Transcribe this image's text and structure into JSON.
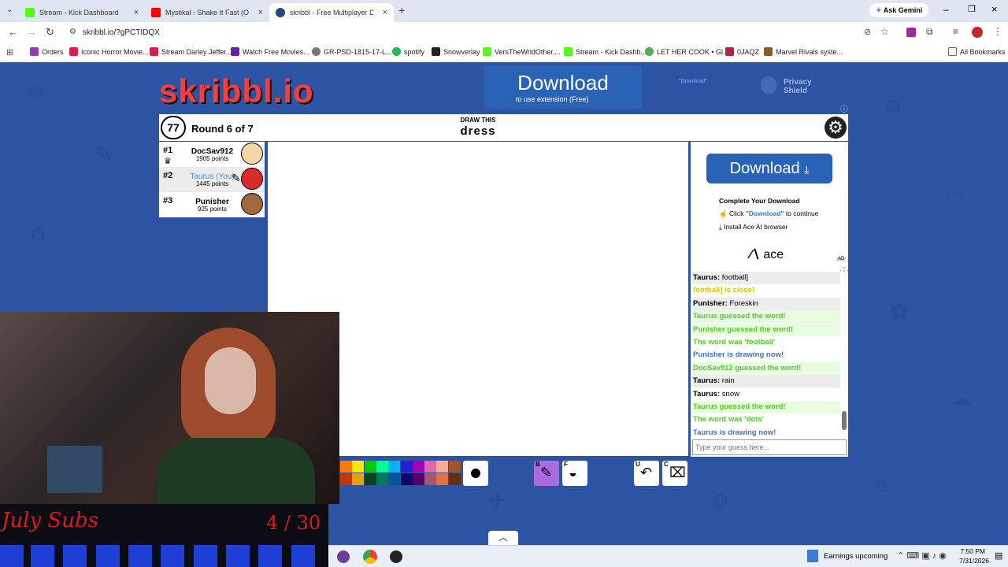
{
  "browser": {
    "tabs": [
      {
        "title": "Stream - Kick Dashboard",
        "color": "#53fc18"
      },
      {
        "title": "Mystikal - Shake It Fast (Offi",
        "color": "#ff0000"
      },
      {
        "title": "skribbl - Free Multiplayer D",
        "color": "#27467f"
      }
    ],
    "ask_gemini": "Ask Gemini",
    "url": "skribbl.io/?gPCTIDQX",
    "bookmarks": [
      "Orders",
      "Iconic Horror Movie...",
      "Stream Darley Jeffer...",
      "Watch Free Movies...",
      "GR-PSD-1815-17-L...",
      "spotify",
      "Snowverlay",
      "VersTheWrldOther,...",
      "Stream - Kick Dashb...",
      "LET HER COOK • Gl...",
      "0JAQZ",
      "Marvel Rivals syste..."
    ],
    "all_bookmarks": "All Bookmarks"
  },
  "ad_top": {
    "download": "Download",
    "sub": "to use extension (Free)",
    "privacy": "Privacy Shield",
    "tiny_download": "\"Download\""
  },
  "game": {
    "logo": "skribbl.io",
    "timer": "77",
    "round": "Round 6 of 7",
    "draw_this": "DRAW THIS",
    "word": "dress",
    "players": [
      {
        "rank": "#1",
        "name": "DocSav912",
        "points": "1905 points",
        "color": "#000000"
      },
      {
        "rank": "#2",
        "name": "Taurus (You)",
        "points": "1445 points",
        "color": "#4a8cd8"
      },
      {
        "rank": "#3",
        "name": "Punisher",
        "points": "925 points",
        "color": "#000000"
      }
    ],
    "tool_keys": {
      "brush": "B",
      "fill": "F",
      "undo": "U",
      "clear": "C"
    },
    "guess_placeholder": "Type your guess here..."
  },
  "ad_side": {
    "download": "Download",
    "complete": "Complete Your Download",
    "click_prefix": "Click",
    "click_link": "\"Download\"",
    "click_suffix": "to continue",
    "install": "Install Ace AI browser",
    "brand": "ace",
    "ad_label": "AD"
  },
  "chat": [
    {
      "name": "Taurus:",
      "text": "football]",
      "style": "gray"
    },
    {
      "name": "",
      "text": "football] is close!",
      "style": "yel"
    },
    {
      "name": "Punisher:",
      "text": "Foreskin",
      "style": "gray"
    },
    {
      "name": "",
      "text": "Taurus guessed the word!",
      "style": "g"
    },
    {
      "name": "",
      "text": "Punisher guessed the word!",
      "style": "g"
    },
    {
      "name": "",
      "text": "The word was 'football'",
      "style": "g-plain"
    },
    {
      "name": "",
      "text": "Punisher is drawing now!",
      "style": "blue"
    },
    {
      "name": "",
      "text": "DocSav912 guessed the word!",
      "style": "g"
    },
    {
      "name": "Taurus:",
      "text": "rain",
      "style": "gray"
    },
    {
      "name": "Taurus:",
      "text": "snow",
      "style": "plain"
    },
    {
      "name": "",
      "text": "Taurus guessed the word!",
      "style": "g"
    },
    {
      "name": "",
      "text": "The word was 'dots'",
      "style": "g-plain"
    },
    {
      "name": "",
      "text": "Taurus is drawing now!",
      "style": "blue"
    }
  ],
  "overlay": {
    "label": "July Subs",
    "count": "4 / 30"
  },
  "taskbar": {
    "news": "Earnings upcoming",
    "time": "7:50 PM",
    "date": "7/31/2026"
  },
  "palette": [
    "#ff7a00",
    "#ffe600",
    "#00cc00",
    "#00ff91",
    "#00b2ff",
    "#231fd3",
    "#a300ba",
    "#df69a7",
    "#ffac8e",
    "#a0522d",
    "#c13900",
    "#e8a200",
    "#004619",
    "#007a5c",
    "#00569e",
    "#0e0865",
    "#550069",
    "#a75574",
    "#e3723e",
    "#63300d"
  ],
  "colors": {
    "page_bg": "#2c54a3",
    "accent": "#2a62b5",
    "overlay_text": "#d81a1a"
  }
}
